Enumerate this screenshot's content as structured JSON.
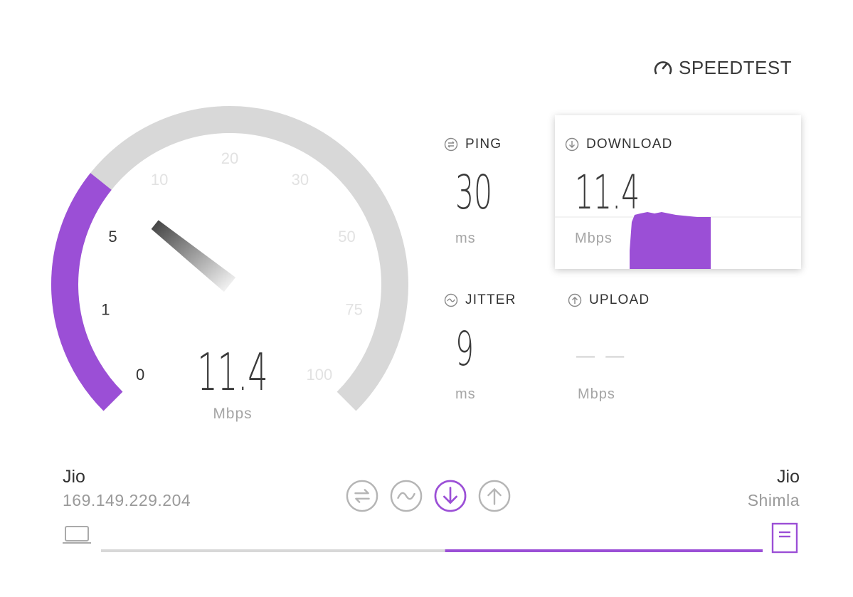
{
  "brand": {
    "name": "SPEEDTEST"
  },
  "gauge": {
    "ticks": [
      "0",
      "1",
      "5",
      "10",
      "20",
      "30",
      "50",
      "75",
      "100"
    ],
    "progress_fraction": 0.31,
    "value": "11.4",
    "unit": "Mbps"
  },
  "metrics": {
    "ping": {
      "label": "PING",
      "value": "30",
      "unit": "ms"
    },
    "jitter": {
      "label": "JITTER",
      "value": "9",
      "unit": "ms"
    },
    "download": {
      "label": "DOWNLOAD",
      "value": "11.4",
      "unit": "Mbps"
    },
    "upload": {
      "label": "UPLOAD",
      "value": "— —",
      "unit": "Mbps"
    }
  },
  "client": {
    "isp": "Jio",
    "ip": "169.149.229.204"
  },
  "server": {
    "isp": "Jio",
    "location": "Shimla"
  },
  "progress": {
    "fraction": 0.52
  },
  "phases": [
    {
      "name": "ping",
      "icon": "ping-icon",
      "active": false
    },
    {
      "name": "jitter",
      "icon": "jitter-icon",
      "active": false
    },
    {
      "name": "download",
      "icon": "download-icon",
      "active": true
    },
    {
      "name": "upload",
      "icon": "upload-icon",
      "active": false
    }
  ],
  "colors": {
    "accent": "#9b4fd6",
    "track": "#d8d8d8",
    "muted": "#b5b5b5",
    "text": "#333333"
  }
}
